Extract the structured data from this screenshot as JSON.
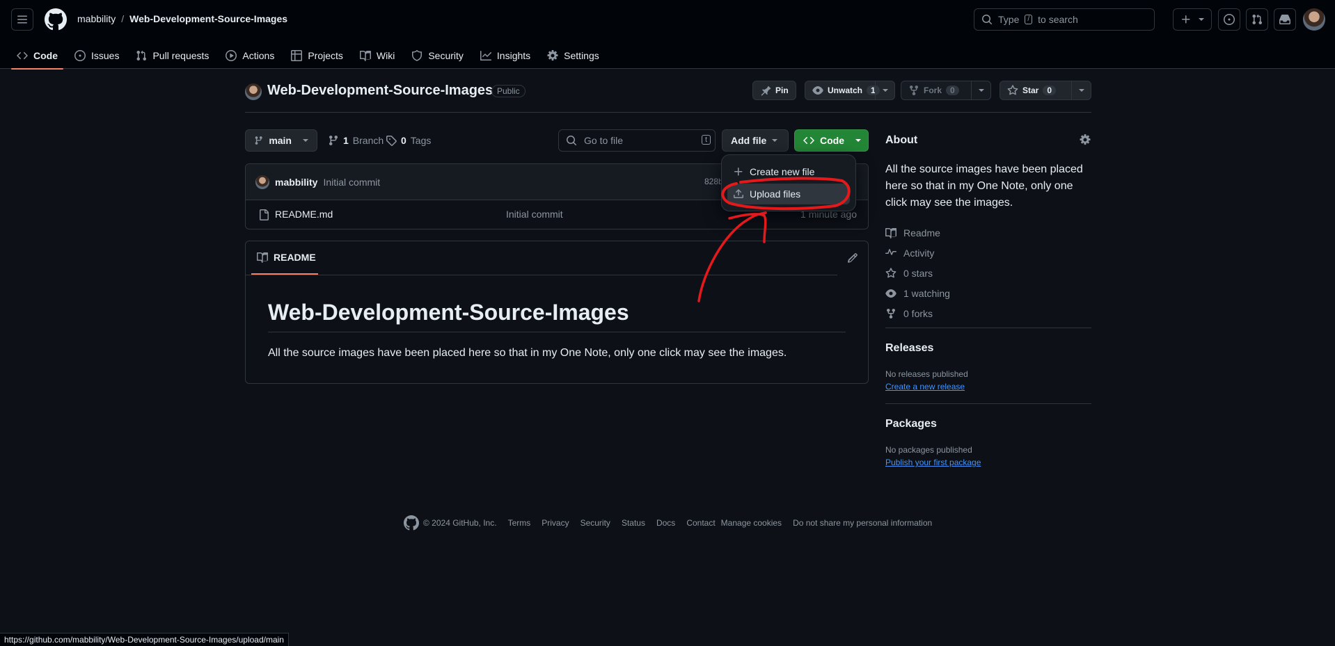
{
  "header": {
    "owner": "mabbility",
    "separator": "/",
    "repo": "Web-Development-Source-Images",
    "search_prefix": "Type",
    "search_key": "/",
    "search_suffix": "to search"
  },
  "tabs": [
    {
      "label": "Code",
      "icon": "code-icon",
      "active": true
    },
    {
      "label": "Issues",
      "icon": "issue-icon"
    },
    {
      "label": "Pull requests",
      "icon": "pull-request-icon"
    },
    {
      "label": "Actions",
      "icon": "play-icon"
    },
    {
      "label": "Projects",
      "icon": "table-icon"
    },
    {
      "label": "Wiki",
      "icon": "book-icon"
    },
    {
      "label": "Security",
      "icon": "shield-icon"
    },
    {
      "label": "Insights",
      "icon": "graph-icon"
    },
    {
      "label": "Settings",
      "icon": "gear-icon"
    }
  ],
  "repo_header": {
    "name": "Web-Development-Source-Images",
    "visibility": "Public",
    "pin_label": "Pin",
    "unwatch_label": "Unwatch",
    "watch_count": "1",
    "fork_label": "Fork",
    "fork_count": "0",
    "star_label": "Star",
    "star_count": "0"
  },
  "toolbar": {
    "branch": "main",
    "branch_count": "1",
    "branch_label": "Branch",
    "tag_count": "0",
    "tag_label": "Tags",
    "goto_placeholder": "Go to file",
    "goto_key": "t",
    "add_file_label": "Add file",
    "code_label": "Code"
  },
  "add_file_menu": {
    "items": [
      {
        "label": "Create new file",
        "icon": "plus-icon"
      },
      {
        "label": "Upload files",
        "icon": "upload-icon",
        "highlighted": true
      }
    ]
  },
  "commit": {
    "author": "mabbility",
    "message": "Initial commit",
    "sha": "828b"
  },
  "files": [
    {
      "name": "README.md",
      "message": "Initial commit",
      "age": "1 minute ago",
      "icon": "file-icon"
    }
  ],
  "readme": {
    "tab_label": "README",
    "heading": "Web-Development-Source-Images",
    "body": "All the source images have been placed here so that in my One Note, only one click may see the images."
  },
  "about": {
    "title": "About",
    "description": "All the source images have been placed here so that in my One Note, only one click may see the images.",
    "items": [
      {
        "label": "Readme",
        "icon": "book-icon"
      },
      {
        "label": "Activity",
        "icon": "pulse-icon"
      },
      {
        "label": "0 stars",
        "icon": "star-icon"
      },
      {
        "label": "1 watching",
        "icon": "eye-icon"
      },
      {
        "label": "0 forks",
        "icon": "fork-icon"
      }
    ]
  },
  "releases": {
    "title": "Releases",
    "status": "No releases published",
    "link": "Create a new release"
  },
  "packages": {
    "title": "Packages",
    "status": "No packages published",
    "link": "Publish your first package"
  },
  "footer": {
    "copyright": "© 2024 GitHub, Inc.",
    "links": [
      "Terms",
      "Privacy",
      "Security",
      "Status",
      "Docs",
      "Contact",
      "Manage cookies",
      "Do not share my personal information"
    ]
  },
  "status_url": "https://github.com/mabbility/Web-Development-Source-Images/upload/main",
  "colors": {
    "background": "#0d1117",
    "header_bg": "#010409",
    "border": "#30363d",
    "accent_tab": "#f78166",
    "primary_button": "#238636",
    "link": "#4493f8",
    "annotation": "#e5191c"
  }
}
